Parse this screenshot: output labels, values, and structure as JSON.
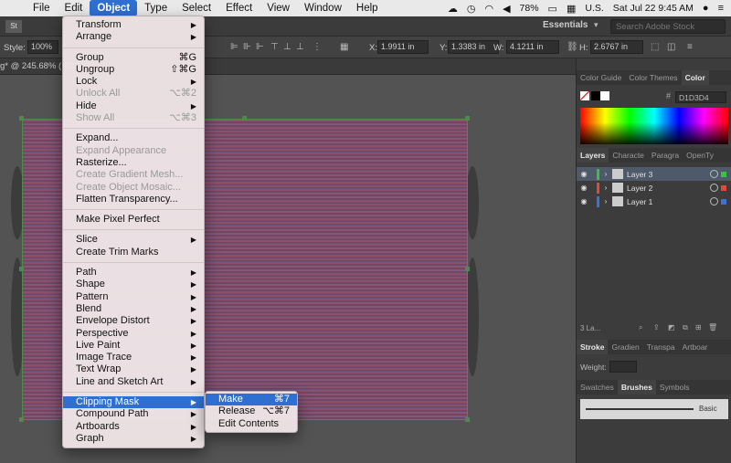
{
  "menubar": {
    "items": [
      "File",
      "Edit",
      "Object",
      "Type",
      "Select",
      "Effect",
      "View",
      "Window",
      "Help"
    ],
    "active_index": 2,
    "battery": "78%",
    "input_source": "U.S.",
    "clock": "Sat Jul 22  9:45 AM"
  },
  "app": {
    "badge": "St",
    "workspace": "Essentials",
    "search_placeholder": "Search Adobe Stock"
  },
  "control_bar": {
    "style_label": "Style:",
    "opacity": "100%",
    "x_label": "X:",
    "x_value": "1.9911 in",
    "y_label": "Y:",
    "y_value": "1.3383 in",
    "w_label": "W:",
    "w_value": "4.1211 in",
    "h_label": "H:",
    "h_value": "2.6767 in"
  },
  "document": {
    "tab_title": "g* @ 245.68% (RGB..."
  },
  "object_menu": [
    {
      "label": "Transform",
      "arrow": true
    },
    {
      "label": "Arrange",
      "arrow": true
    },
    {
      "sep": true
    },
    {
      "label": "Group",
      "shortcut": "⌘G"
    },
    {
      "label": "Ungroup",
      "shortcut": "⇧⌘G"
    },
    {
      "label": "Lock",
      "arrow": true
    },
    {
      "label": "Unlock All",
      "shortcut": "⌥⌘2",
      "disabled": true
    },
    {
      "label": "Hide",
      "arrow": true
    },
    {
      "label": "Show All",
      "shortcut": "⌥⌘3",
      "disabled": true
    },
    {
      "sep": true
    },
    {
      "label": "Expand..."
    },
    {
      "label": "Expand Appearance",
      "disabled": true
    },
    {
      "label": "Rasterize..."
    },
    {
      "label": "Create Gradient Mesh...",
      "disabled": true
    },
    {
      "label": "Create Object Mosaic...",
      "disabled": true
    },
    {
      "label": "Flatten Transparency..."
    },
    {
      "sep": true
    },
    {
      "label": "Make Pixel Perfect"
    },
    {
      "sep": true
    },
    {
      "label": "Slice",
      "arrow": true
    },
    {
      "label": "Create Trim Marks"
    },
    {
      "sep": true
    },
    {
      "label": "Path",
      "arrow": true
    },
    {
      "label": "Shape",
      "arrow": true
    },
    {
      "label": "Pattern",
      "arrow": true
    },
    {
      "label": "Blend",
      "arrow": true
    },
    {
      "label": "Envelope Distort",
      "arrow": true
    },
    {
      "label": "Perspective",
      "arrow": true
    },
    {
      "label": "Live Paint",
      "arrow": true
    },
    {
      "label": "Image Trace",
      "arrow": true
    },
    {
      "label": "Text Wrap",
      "arrow": true
    },
    {
      "label": "Line and Sketch Art",
      "arrow": true
    },
    {
      "sep": true
    },
    {
      "label": "Clipping Mask",
      "arrow": true,
      "highlighted": true
    },
    {
      "label": "Compound Path",
      "arrow": true
    },
    {
      "label": "Artboards",
      "arrow": true
    },
    {
      "label": "Graph",
      "arrow": true
    }
  ],
  "clipping_submenu": [
    {
      "label": "Make",
      "shortcut": "⌘7",
      "highlighted": true
    },
    {
      "label": "Release",
      "shortcut": "⌥⌘7"
    },
    {
      "label": "Edit Contents"
    }
  ],
  "color_panel": {
    "tabs": [
      "Color Guide",
      "Color Themes",
      "Color"
    ],
    "active_tab": 2,
    "hex_value": "D1D3D4"
  },
  "layers_panel": {
    "tabs": [
      "Layers",
      "Characte",
      "Paragra",
      "OpenTy"
    ],
    "active_tab": 0,
    "layers": [
      {
        "name": "Layer 3",
        "color": "#3fbf3f",
        "selected": true
      },
      {
        "name": "Layer 2",
        "color": "#e04a3a",
        "selected": false
      },
      {
        "name": "Layer 1",
        "color": "#3f6fd8",
        "selected": false
      }
    ],
    "footer_count": "3 La..."
  },
  "stroke_panel": {
    "tabs": [
      "Stroke",
      "Gradien",
      "Transpa",
      "Artboar"
    ],
    "active_tab": 0,
    "weight_label": "Weight:"
  },
  "brushes_panel": {
    "tabs": [
      "Swatches",
      "Brushes",
      "Symbols"
    ],
    "active_tab": 1,
    "brush_name": "Basic"
  }
}
